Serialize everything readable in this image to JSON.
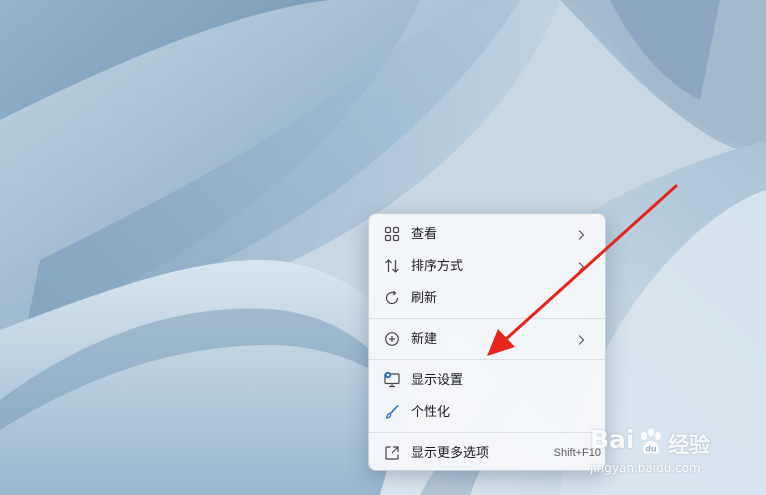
{
  "context_menu": {
    "items": [
      {
        "label": "查看",
        "icon": "grid-view-icon",
        "has_submenu": true
      },
      {
        "label": "排序方式",
        "icon": "sort-arrows-icon",
        "has_submenu": true
      },
      {
        "label": "刷新",
        "icon": "refresh-icon",
        "has_submenu": false
      },
      {
        "label": "新建",
        "icon": "add-circle-icon",
        "has_submenu": true
      },
      {
        "label": "显示设置",
        "icon": "display-settings-icon",
        "has_submenu": false
      },
      {
        "label": "个性化",
        "icon": "brush-icon",
        "has_submenu": false
      },
      {
        "label": "显示更多选项",
        "icon": "open-external-icon",
        "has_submenu": false,
        "shortcut": "Shift+F10"
      }
    ]
  },
  "annotation": {
    "arrow_color": "#e8251d"
  },
  "watermark": {
    "brand": "Bai",
    "brand2": "经验",
    "url": "jingyan.baidu.com"
  },
  "colors": {
    "menu_background": "#f5f7fa",
    "icon_accent": "#2b6fbf",
    "text": "#1b1b1b"
  }
}
